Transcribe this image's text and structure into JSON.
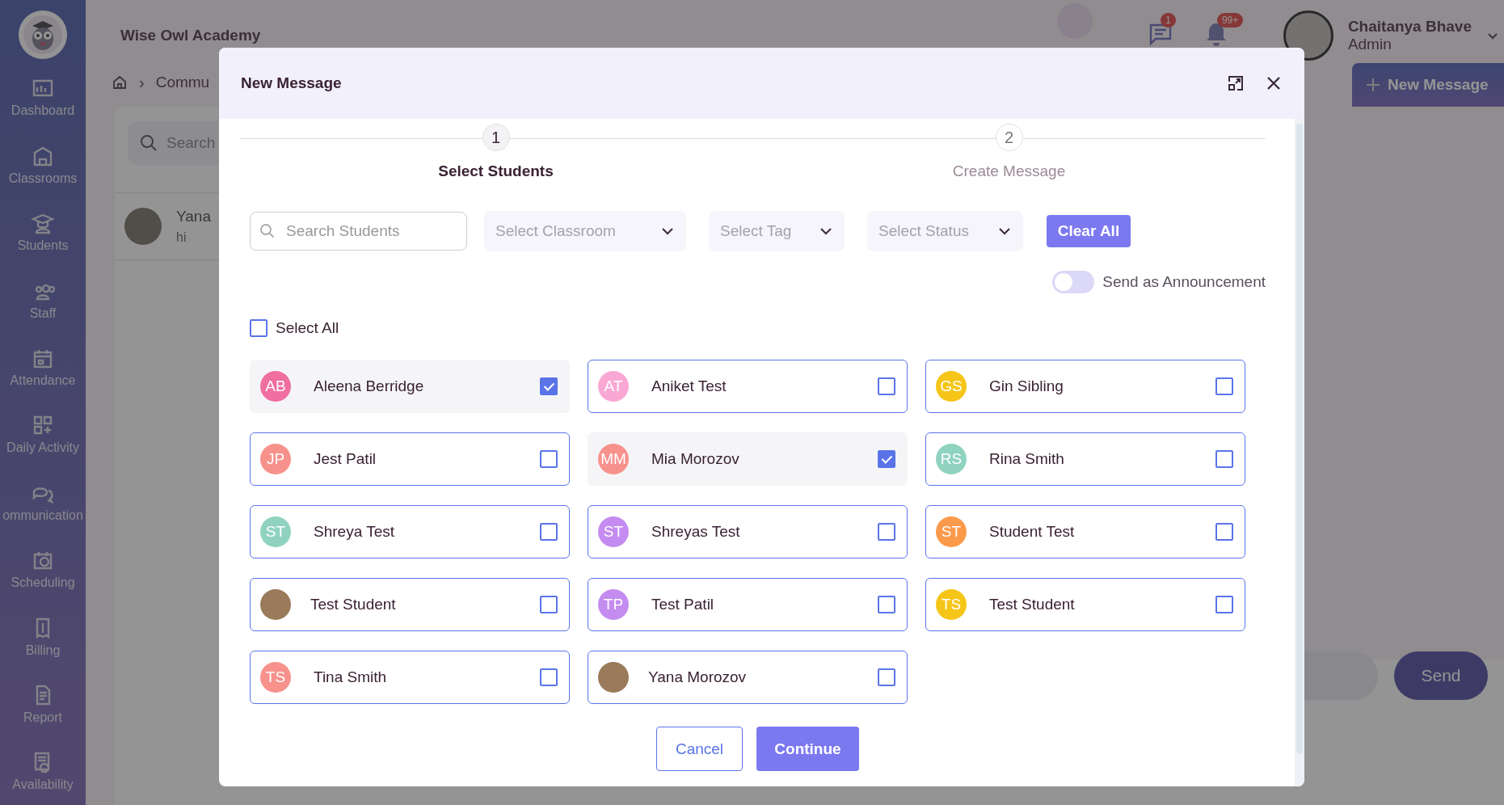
{
  "sidebar": {
    "items": [
      {
        "label": "Dashboard"
      },
      {
        "label": "Classrooms"
      },
      {
        "label": "Students"
      },
      {
        "label": "Staff"
      },
      {
        "label": "Attendance"
      },
      {
        "label": "Daily Activity"
      },
      {
        "label": "ommunication"
      },
      {
        "label": "Scheduling"
      },
      {
        "label": "Billing"
      },
      {
        "label": "Report"
      },
      {
        "label": "Availability"
      }
    ]
  },
  "header": {
    "school": "Wise Owl Academy",
    "breadcrumb_separator": "›",
    "breadcrumb": "Commu",
    "messages_badge": "1",
    "notifications_badge": "99+",
    "user": {
      "name": "Chaitanya Bhave",
      "role": "Admin"
    },
    "new_message_button": "New Message"
  },
  "conversation_search": {
    "placeholder": "Search"
  },
  "conversations": [
    {
      "name": "Yana",
      "preview": "hi"
    }
  ],
  "composer": {
    "send_button": "Send"
  },
  "modal": {
    "title": "New Message",
    "steps": [
      {
        "number": "1",
        "label": "Select Students",
        "selected": true
      },
      {
        "number": "2",
        "label": "Create Message",
        "selected": false
      }
    ],
    "search": {
      "placeholder": "Search Students"
    },
    "filters": [
      {
        "placeholder": "Select Classroom"
      },
      {
        "placeholder": "Select Tag"
      },
      {
        "placeholder": "Select Status"
      }
    ],
    "clear_button": "Clear All",
    "announcement": {
      "label": "Send as Announcement",
      "on": false
    },
    "select_all": {
      "label": "Select All",
      "checked": false
    },
    "students": [
      {
        "kind": "initials",
        "initials": "AB",
        "name": "Aleena Berridge",
        "color": "#f06ea0",
        "selected": true
      },
      {
        "kind": "initials",
        "initials": "AT",
        "name": "Aniket Test",
        "color": "#f9a8d4",
        "selected": false
      },
      {
        "kind": "initials",
        "initials": "GS",
        "name": "Gin Sibling",
        "color": "#f5c518",
        "selected": false
      },
      {
        "kind": "initials",
        "initials": "JP",
        "name": "Jest Patil",
        "color": "#f7918c",
        "selected": false
      },
      {
        "kind": "initials",
        "initials": "MM",
        "name": "Mia Morozov",
        "color": "#f7918c",
        "selected": true
      },
      {
        "kind": "initials",
        "initials": "RS",
        "name": "Rina Smith",
        "color": "#8fd3bf",
        "selected": false
      },
      {
        "kind": "initials",
        "initials": "ST",
        "name": "Shreya Test",
        "color": "#8fd3bf",
        "selected": false
      },
      {
        "kind": "initials",
        "initials": "ST",
        "name": "Shreyas Test",
        "color": "#c48cf0",
        "selected": false
      },
      {
        "kind": "initials",
        "initials": "ST",
        "name": "Student Test",
        "color": "#fb9a4b",
        "selected": false
      },
      {
        "kind": "photo",
        "name": "Test Student",
        "selected": false
      },
      {
        "kind": "initials",
        "initials": "TP",
        "name": "Test Patil",
        "color": "#c48cf0",
        "selected": false
      },
      {
        "kind": "initials",
        "initials": "TS",
        "name": "Test Student",
        "color": "#f5c518",
        "selected": false
      },
      {
        "kind": "initials",
        "initials": "TS",
        "name": "Tina Smith",
        "color": "#f7918c",
        "selected": false
      },
      {
        "kind": "photo",
        "name": "Yana Morozov",
        "selected": false
      }
    ],
    "cancel_button": "Cancel",
    "continue_button": "Continue"
  }
}
